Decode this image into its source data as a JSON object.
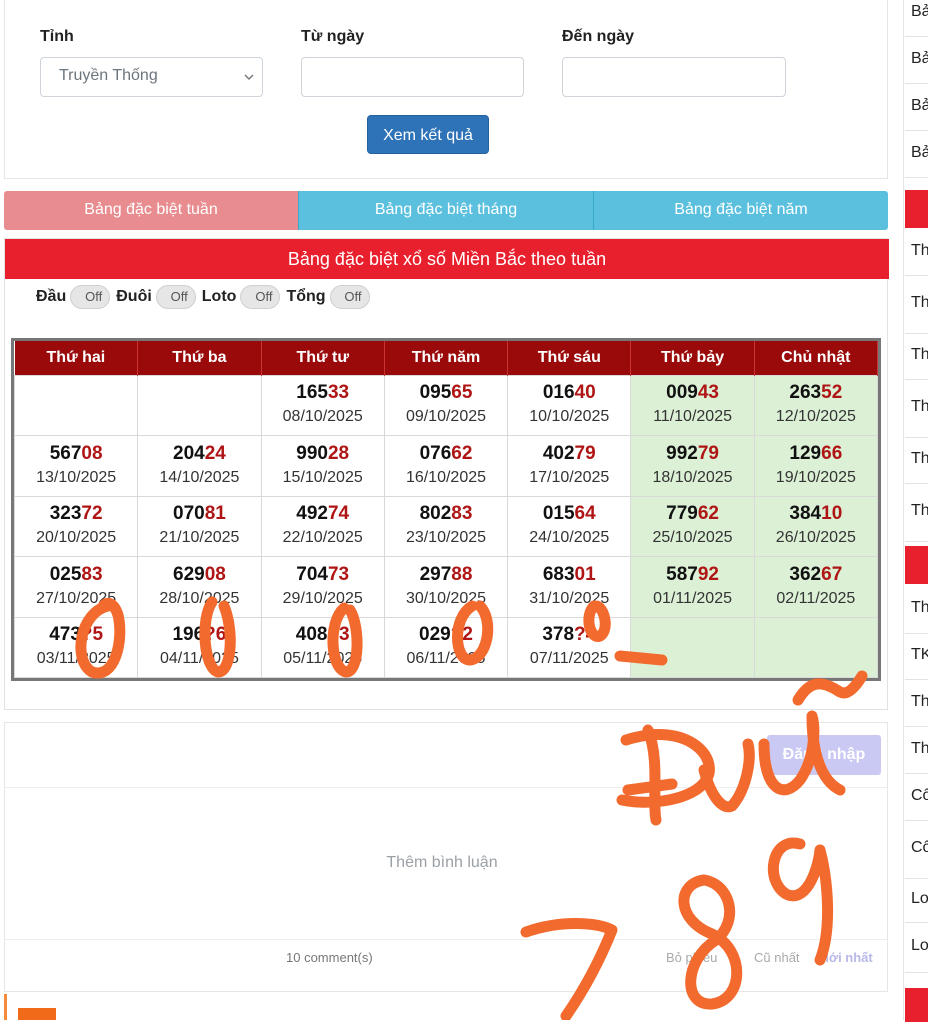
{
  "filter": {
    "province_label": "Tỉnh",
    "province_value": "Truyền Thống",
    "from_label": "Từ ngày",
    "from_value": "",
    "to_label": "Đến ngày",
    "to_value": "",
    "submit_label": "Xem kết quả"
  },
  "tabs": [
    "Bảng đặc biệt tuần",
    "Bảng đặc biệt tháng",
    "Bảng đặc biệt năm"
  ],
  "table_title": "Bảng đặc biệt xổ số Miền Bắc theo tuần",
  "toggles": [
    {
      "label": "Đầu",
      "state": "Off"
    },
    {
      "label": "Đuôi",
      "state": "Off"
    },
    {
      "label": "Loto",
      "state": "Off"
    },
    {
      "label": "Tổng",
      "state": "Off"
    }
  ],
  "days": [
    "Thứ hai",
    "Thứ ba",
    "Thứ tư",
    "Thứ năm",
    "Thứ sáu",
    "Thứ bảy",
    "Chủ nhật"
  ],
  "rows": [
    [
      null,
      null,
      {
        "head": "165",
        "tail": "33",
        "date": "08/10/2025"
      },
      {
        "head": "095",
        "tail": "65",
        "date": "09/10/2025"
      },
      {
        "head": "016",
        "tail": "40",
        "date": "10/10/2025"
      },
      {
        "head": "009",
        "tail": "43",
        "date": "11/10/2025"
      },
      {
        "head": "263",
        "tail": "52",
        "date": "12/10/2025"
      }
    ],
    [
      {
        "head": "567",
        "tail": "08",
        "date": "13/10/2025"
      },
      {
        "head": "204",
        "tail": "24",
        "date": "14/10/2025"
      },
      {
        "head": "990",
        "tail": "28",
        "date": "15/10/2025"
      },
      {
        "head": "076",
        "tail": "62",
        "date": "16/10/2025"
      },
      {
        "head": "402",
        "tail": "79",
        "date": "17/10/2025"
      },
      {
        "head": "992",
        "tail": "79",
        "date": "18/10/2025"
      },
      {
        "head": "129",
        "tail": "66",
        "date": "19/10/2025"
      }
    ],
    [
      {
        "head": "323",
        "tail": "72",
        "date": "20/10/2025"
      },
      {
        "head": "070",
        "tail": "81",
        "date": "21/10/2025"
      },
      {
        "head": "492",
        "tail": "74",
        "date": "22/10/2025"
      },
      {
        "head": "802",
        "tail": "83",
        "date": "23/10/2025"
      },
      {
        "head": "015",
        "tail": "64",
        "date": "24/10/2025"
      },
      {
        "head": "779",
        "tail": "62",
        "date": "25/10/2025"
      },
      {
        "head": "384",
        "tail": "10",
        "date": "26/10/2025"
      }
    ],
    [
      {
        "head": "025",
        "tail": "83",
        "date": "27/10/2025"
      },
      {
        "head": "629",
        "tail": "08",
        "date": "28/10/2025"
      },
      {
        "head": "704",
        "tail": "73",
        "date": "29/10/2025"
      },
      {
        "head": "297",
        "tail": "88",
        "date": "30/10/2025"
      },
      {
        "head": "683",
        "tail": "01",
        "date": "31/10/2025"
      },
      {
        "head": "587",
        "tail": "92",
        "date": "01/11/2025"
      },
      {
        "head": "362",
        "tail": "67",
        "date": "02/11/2025"
      }
    ],
    [
      {
        "head": "473",
        "tail": "?5",
        "date": "03/11/2025"
      },
      {
        "head": "196",
        "tail": "?6",
        "date": "04/11/2025"
      },
      {
        "head": "408",
        "tail": "?3",
        "date": "05/11/2025"
      },
      {
        "head": "029",
        "tail": "?2",
        "date": "06/11/2025"
      },
      {
        "head": "378",
        "tail": "?4",
        "date": "07/11/2025"
      },
      null,
      null
    ]
  ],
  "comments": {
    "login_label": "Đăng nhập",
    "placeholder": "Thêm bình luận",
    "count_text": "10 comment(s)",
    "sort_options": [
      "Bỏ phiếu",
      "Cũ nhất",
      "Mới nhất"
    ]
  },
  "sidebar": {
    "items_top": [
      "Bả",
      "Bả",
      "Bả",
      "Bả"
    ],
    "items_mid": [
      "Th",
      "Th lot",
      "Th",
      "Th lot",
      "Th",
      "Th the"
    ],
    "items_bottom": [
      "Th",
      "TK",
      "Th",
      "Th",
      "Cô",
      "Cô VI",
      "Lo",
      "Lo ca"
    ]
  },
  "handwriting": {
    "text": "Đvũ 789",
    "color": "#f26a2e"
  }
}
